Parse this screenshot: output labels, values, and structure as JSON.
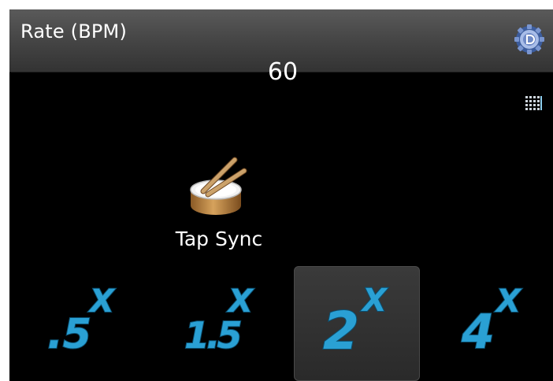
{
  "header": {
    "rate_label": "Rate (BPM)",
    "rate_value": "60",
    "settings_icon": "gear-disc-icon"
  },
  "grid_icon": "grid-icon",
  "tap_sync": {
    "label": "Tap Sync",
    "icon": "drum-icon"
  },
  "multipliers": [
    {
      "number": ".5",
      "suffix": "X",
      "selected": false
    },
    {
      "number": "1.5",
      "suffix": "X",
      "selected": false
    },
    {
      "number": "2",
      "suffix": "X",
      "selected": true
    },
    {
      "number": "4",
      "suffix": "X",
      "selected": false
    }
  ],
  "colors": {
    "background": "#000000",
    "header_top": "#5a5a5a",
    "header_bottom": "#333333",
    "multiplier_fill": "#2aa0d4",
    "multiplier_stroke": "#0b4f70"
  }
}
